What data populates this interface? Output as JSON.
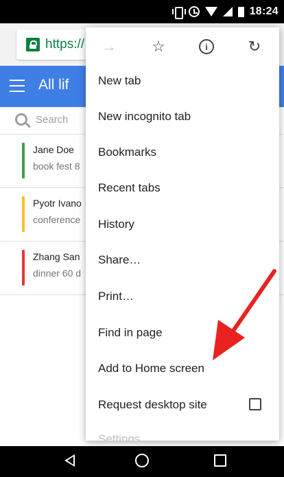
{
  "status_bar": {
    "time": "18:24"
  },
  "browser": {
    "url": "https://"
  },
  "app_bar": {
    "title": "All lif"
  },
  "search": {
    "placeholder": "Search"
  },
  "contacts": [
    {
      "name": "Jane Doe",
      "note": "book fest 8",
      "color": "#43a047"
    },
    {
      "name": "Pyotr Ivano",
      "note": "conference",
      "color": "#fbc02d"
    },
    {
      "name": "Zhang San",
      "note": "dinner 60 d",
      "color": "#e53935"
    }
  ],
  "menu": {
    "items": [
      "New tab",
      "New incognito tab",
      "Bookmarks",
      "Recent tabs",
      "History",
      "Share…",
      "Print…",
      "Find in page",
      "Add to Home screen",
      "Request desktop site",
      "Settings"
    ]
  },
  "colors": {
    "accent": "#3f7ee5",
    "secure_green": "#0b8043",
    "annotation_red": "#e8231f"
  }
}
